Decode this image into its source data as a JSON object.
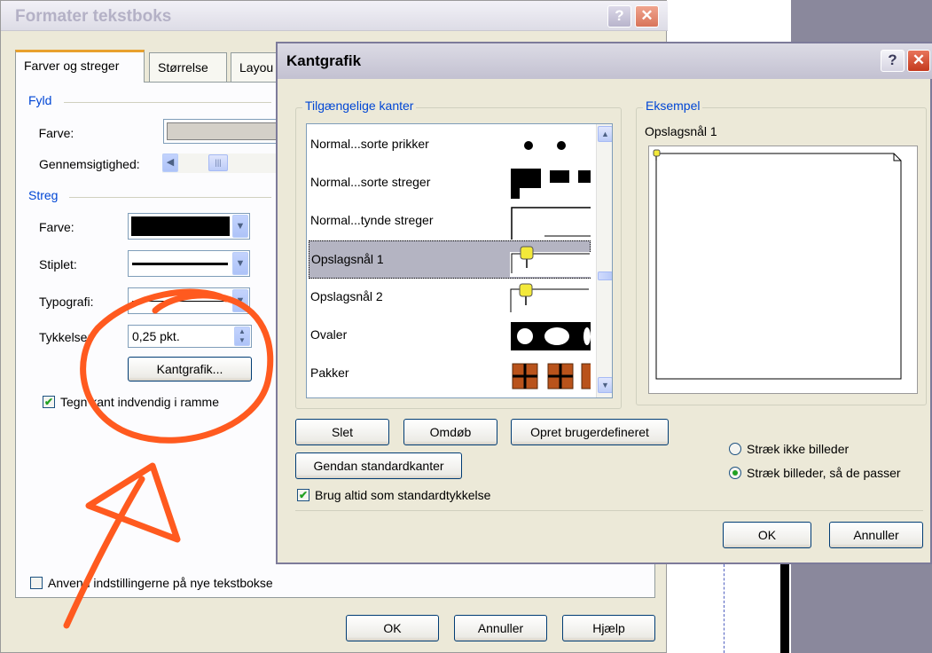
{
  "dialog1": {
    "title": "Formater tekstboks",
    "tabs": [
      {
        "label": "Farver og streger",
        "active": true
      },
      {
        "label": "Størrelse",
        "active": false
      },
      {
        "label": "Layou",
        "active": false
      }
    ],
    "fill_group": "Fyld",
    "fill_color_label": "Farve:",
    "transparency_label": "Gennemsigtighed:",
    "line_group": "Streg",
    "line_color_label": "Farve:",
    "dash_label": "Stiplet:",
    "style_label": "Typografi:",
    "weight_label": "Tykkelse:",
    "weight_value": "0,25 pkt.",
    "border_art_button": "Kantgrafik...",
    "draw_inside_checkbox": "Tegn kant indvendig i ramme",
    "draw_inside_checked": true,
    "apply_new_checkbox": "Anvend indstillingerne på nye tekstbokse",
    "apply_new_checked": false,
    "ok_button": "OK",
    "cancel_button": "Annuller",
    "help_button": "Hjælp"
  },
  "dialog2": {
    "title": "Kantgrafik",
    "available_group": "Tilgængelige kanter",
    "borders": [
      {
        "name": "Normal...sorte prikker",
        "selected": false
      },
      {
        "name": "Normal...sorte streger",
        "selected": false
      },
      {
        "name": "Normal...tynde streger",
        "selected": false
      },
      {
        "name": "Opslagsnål 1",
        "selected": true
      },
      {
        "name": "Opslagsnål 2",
        "selected": false
      },
      {
        "name": "Ovaler",
        "selected": false
      },
      {
        "name": "Pakker",
        "selected": false
      }
    ],
    "preview_group": "Eksempel",
    "preview_name": "Opslagsnål 1",
    "delete_button": "Slet",
    "rename_button": "Omdøb",
    "create_custom_button": "Opret brugerdefineret",
    "restore_defaults_button": "Gendan standardkanter",
    "always_default_checkbox": "Brug altid som standardtykkelse",
    "always_default_checked": true,
    "radio_no_stretch": "Stræk ikke billeder",
    "radio_stretch_fit": "Stræk billeder, så de passer",
    "selected_radio": "Stræk billeder, så de passer",
    "ok_button": "OK",
    "cancel_button": "Annuller"
  },
  "icons": [
    "help-icon",
    "close-icon",
    "chevron-down-icon",
    "spinner-icon",
    "scroll-up-icon",
    "scroll-down-icon",
    "pushpin-icon"
  ],
  "colors": {
    "accent": "#0046d5",
    "annotation": "#ff5a1f",
    "selection": "#b4b4c2"
  }
}
